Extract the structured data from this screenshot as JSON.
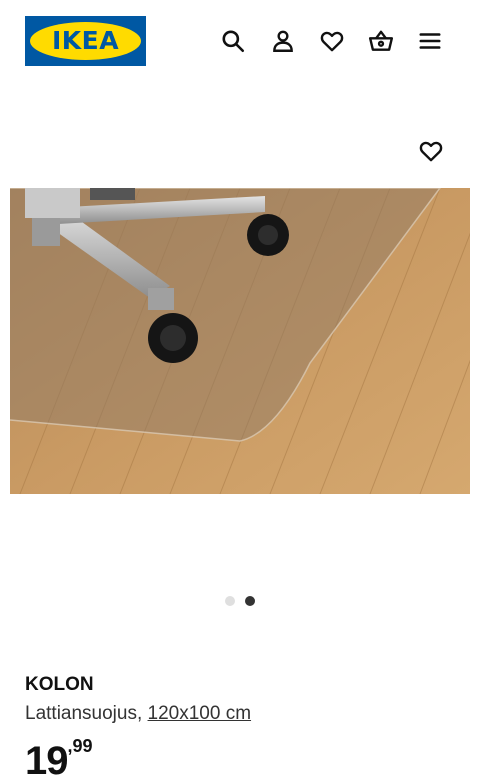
{
  "header": {
    "logo_text": "IKEA",
    "icons": [
      "search-icon",
      "account-icon",
      "favourites-icon",
      "basket-icon",
      "menu-icon"
    ]
  },
  "product": {
    "favourite_icon": "heart-icon",
    "image_subject": "floor-protector-mat",
    "carousel": {
      "total": 2,
      "active": 2
    },
    "brand": "KOLON",
    "type_label": "Lattiansuojus,",
    "size_label": "120x100 cm",
    "price_integer": "19",
    "price_decimal": ",99"
  },
  "colors": {
    "brand_blue": "#0058a3",
    "brand_yellow": "#ffdb00",
    "dot_active": "#333333",
    "dot_inactive": "#dfdfdf"
  }
}
